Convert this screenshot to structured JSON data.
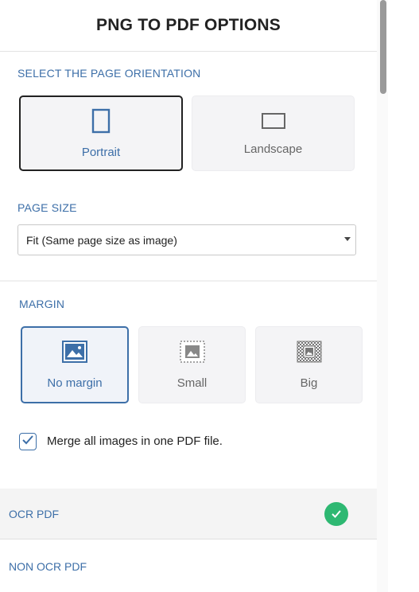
{
  "header": {
    "title": "PNG TO PDF OPTIONS"
  },
  "orientation": {
    "label": "SELECT THE PAGE ORIENTATION",
    "options": [
      {
        "label": "Portrait",
        "icon": "portrait-page-icon",
        "selected": true
      },
      {
        "label": "Landscape",
        "icon": "landscape-page-icon",
        "selected": false
      }
    ]
  },
  "page_size": {
    "label": "PAGE SIZE",
    "selected": "Fit (Same page size as image)"
  },
  "margin": {
    "label": "MARGIN",
    "options": [
      {
        "label": "No margin",
        "icon": "no-margin-image-icon",
        "selected": true
      },
      {
        "label": "Small",
        "icon": "small-margin-image-icon",
        "selected": false
      },
      {
        "label": "Big",
        "icon": "big-margin-image-icon",
        "selected": false
      }
    ]
  },
  "merge": {
    "label": "Merge all images in one PDF file.",
    "checked": true
  },
  "ocr": {
    "ocr_label": "OCR PDF",
    "ocr_selected": true,
    "non_ocr_label": "NON OCR PDF"
  },
  "colors": {
    "accent": "#3d6fa8",
    "success": "#2eb872",
    "selected_border": "#222222"
  }
}
